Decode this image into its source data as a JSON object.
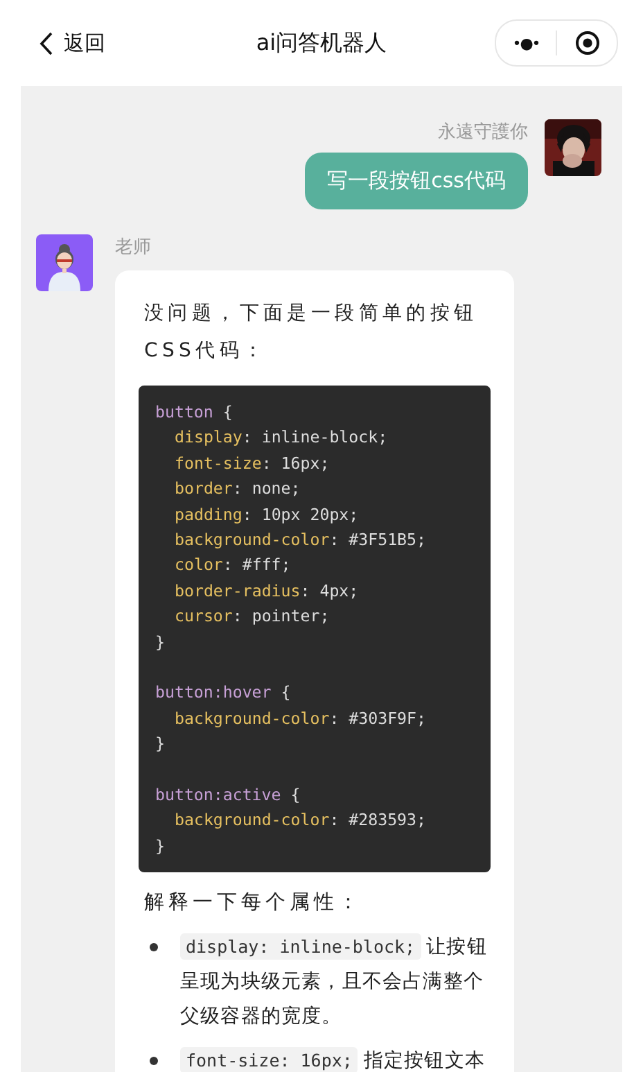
{
  "nav": {
    "back_label": "返回",
    "title": "ai问答机器人",
    "more": "•●•"
  },
  "messages": [
    {
      "kind": "user",
      "sender": "永遠守護你",
      "text": "写一段按钮css代码"
    },
    {
      "kind": "bot",
      "sender": "老师",
      "intro": "没问题，下面是一段简单的按钮CSS代码：",
      "code": [
        {
          "kind": "top",
          "segments": [
            {
              "kind": "sel",
              "text": "button"
            },
            {
              "kind": "plain",
              "text": " {"
            }
          ]
        },
        {
          "kind": "nested",
          "segments": [
            {
              "kind": "prop",
              "text": "display"
            },
            {
              "kind": "plain",
              "text": ": inline-block;"
            }
          ]
        },
        {
          "kind": "nested",
          "segments": [
            {
              "kind": "prop",
              "text": "font-size"
            },
            {
              "kind": "plain",
              "text": ": 16px;"
            }
          ]
        },
        {
          "kind": "nested",
          "segments": [
            {
              "kind": "prop",
              "text": "border"
            },
            {
              "kind": "plain",
              "text": ": none;"
            }
          ]
        },
        {
          "kind": "nested",
          "segments": [
            {
              "kind": "prop",
              "text": "padding"
            },
            {
              "kind": "plain",
              "text": ": 10px 20px;"
            }
          ]
        },
        {
          "kind": "nested",
          "segments": [
            {
              "kind": "prop",
              "text": "background-color"
            },
            {
              "kind": "plain",
              "text": ": #3F51B5;"
            }
          ]
        },
        {
          "kind": "nested",
          "segments": [
            {
              "kind": "prop",
              "text": "color"
            },
            {
              "kind": "plain",
              "text": ": #fff;"
            }
          ]
        },
        {
          "kind": "nested",
          "segments": [
            {
              "kind": "prop",
              "text": "border-radius"
            },
            {
              "kind": "plain",
              "text": ": 4px;"
            }
          ]
        },
        {
          "kind": "nested",
          "segments": [
            {
              "kind": "prop",
              "text": "cursor"
            },
            {
              "kind": "plain",
              "text": ": pointer;"
            }
          ]
        },
        {
          "kind": "top",
          "segments": [
            {
              "kind": "plain",
              "text": "}"
            }
          ]
        },
        {
          "kind": "blank"
        },
        {
          "kind": "top",
          "segments": [
            {
              "kind": "sel",
              "text": "button:hover"
            },
            {
              "kind": "plain",
              "text": " {"
            }
          ]
        },
        {
          "kind": "nested",
          "segments": [
            {
              "kind": "prop",
              "text": "background-color"
            },
            {
              "kind": "plain",
              "text": ": #303F9F;"
            }
          ]
        },
        {
          "kind": "top",
          "segments": [
            {
              "kind": "plain",
              "text": "}"
            }
          ]
        },
        {
          "kind": "blank"
        },
        {
          "kind": "top",
          "segments": [
            {
              "kind": "sel",
              "text": "button:active"
            },
            {
              "kind": "plain",
              "text": " {"
            }
          ]
        },
        {
          "kind": "nested",
          "segments": [
            {
              "kind": "prop",
              "text": "background-color"
            },
            {
              "kind": "plain",
              "text": ": #283593;"
            }
          ]
        },
        {
          "kind": "top",
          "segments": [
            {
              "kind": "plain",
              "text": "}"
            }
          ]
        }
      ],
      "explain": "解释一下每个属性：",
      "bullets": [
        {
          "code": "display: inline-block;",
          "text": "让按钮呈现为块级元素，且不会占满整个父级容器的宽度。"
        },
        {
          "code": "font-size: 16px;",
          "text": "指定按钮文本"
        }
      ]
    }
  ]
}
